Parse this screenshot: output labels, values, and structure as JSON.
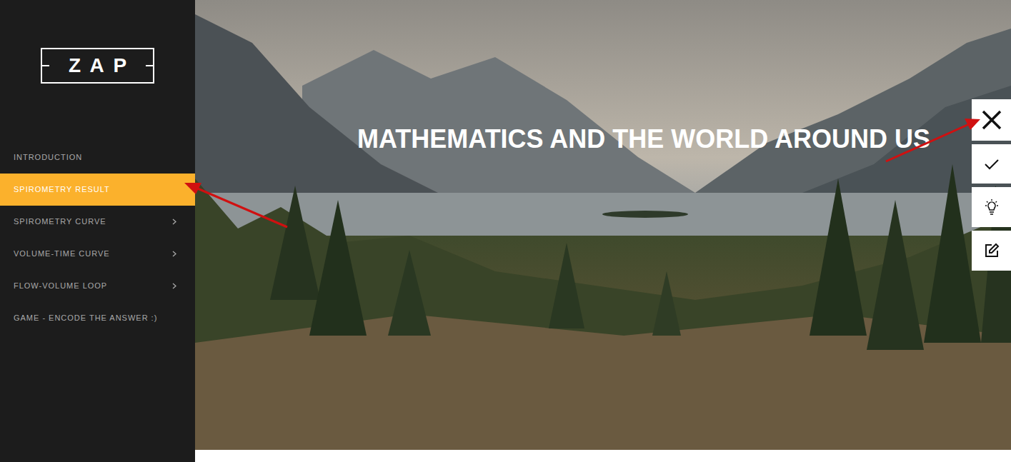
{
  "logo": {
    "text": "ZAP"
  },
  "sidebar": {
    "items": [
      {
        "label": "INTRODUCTION",
        "selected": false,
        "expandable": false
      },
      {
        "label": "SPIROMETRY RESULT",
        "selected": true,
        "expandable": false
      },
      {
        "label": "SPIROMETRY CURVE",
        "selected": false,
        "expandable": true
      },
      {
        "label": "VOLUME-TIME CURVE",
        "selected": false,
        "expandable": true
      },
      {
        "label": "FLOW-VOLUME LOOP",
        "selected": false,
        "expandable": true
      },
      {
        "label": "GAME - ENCODE THE ANSWER :)",
        "selected": false,
        "expandable": false
      }
    ]
  },
  "hero": {
    "title": "MATHEMATICS AND THE WORLD AROUND US"
  }
}
